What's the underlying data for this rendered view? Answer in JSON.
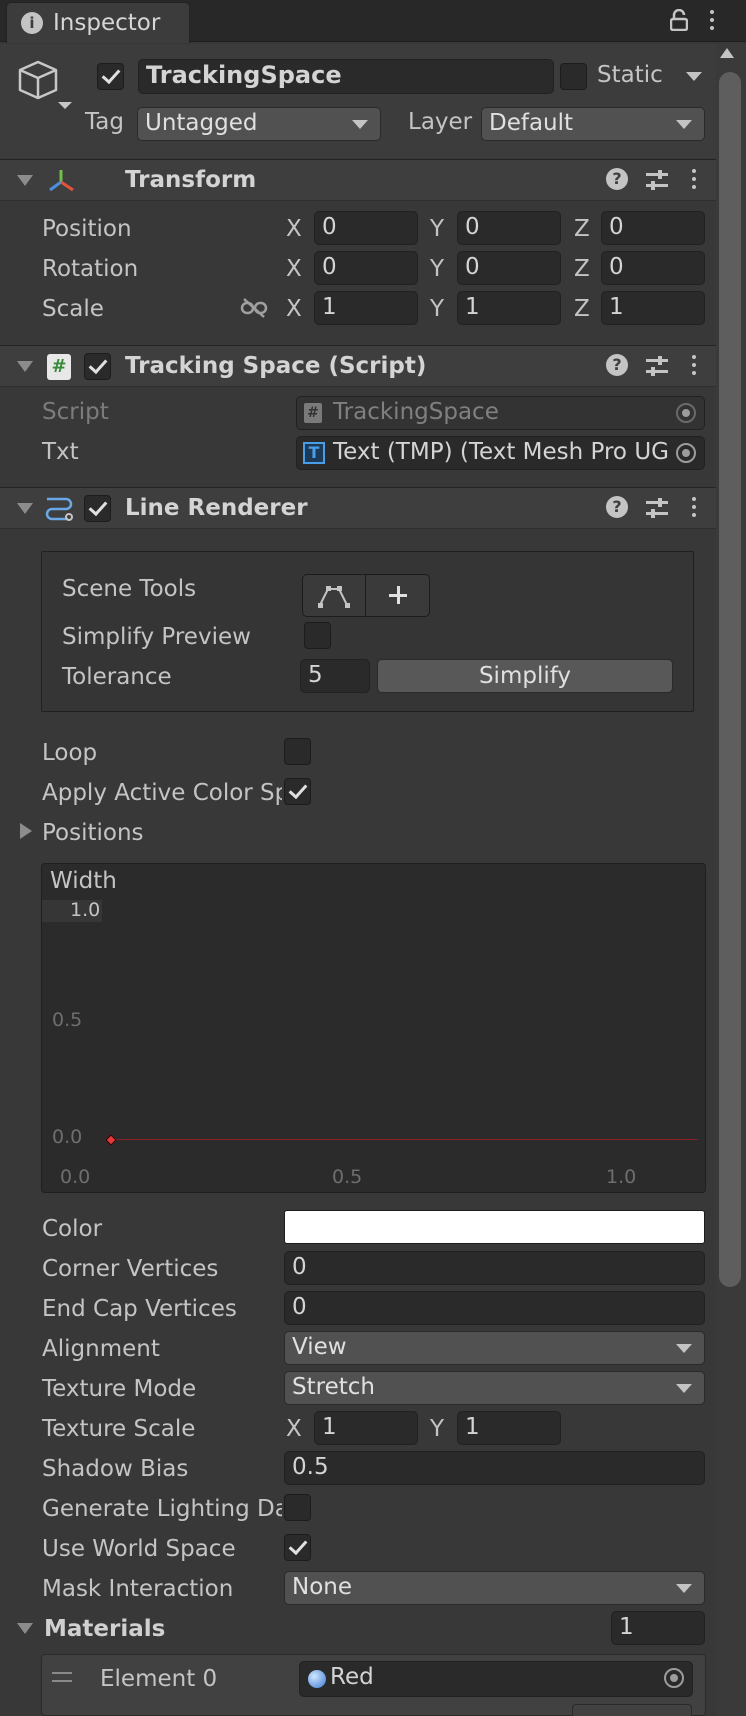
{
  "tab": {
    "title": "Inspector"
  },
  "gameobject": {
    "name": "TrackingSpace",
    "active": true,
    "static_label": "Static",
    "static": false,
    "tag_label": "Tag",
    "tag": "Untagged",
    "layer_label": "Layer",
    "layer": "Default"
  },
  "transform": {
    "title": "Transform",
    "position": {
      "label": "Position",
      "x": "0",
      "y": "0",
      "z": "0"
    },
    "rotation": {
      "label": "Rotation",
      "x": "0",
      "y": "0",
      "z": "0"
    },
    "scale": {
      "label": "Scale",
      "x": "1",
      "y": "1",
      "z": "1"
    },
    "axis_x": "X",
    "axis_y": "Y",
    "axis_z": "Z"
  },
  "tracking_script": {
    "title": "Tracking Space (Script)",
    "enabled": true,
    "script_label": "Script",
    "script_value": "TrackingSpace",
    "txt_label": "Txt",
    "txt_value": "Text (TMP) (Text Mesh Pro UG"
  },
  "line_renderer": {
    "title": "Line Renderer",
    "enabled": true,
    "scene_tools_label": "Scene Tools",
    "simplify_preview_label": "Simplify Preview",
    "tolerance_label": "Tolerance",
    "tolerance_value": "5",
    "simplify_button": "Simplify",
    "loop_label": "Loop",
    "apply_color_label": "Apply Active Color Sp",
    "positions_label": "Positions",
    "width_label": "Width",
    "width_curve": {
      "y_ticks": [
        "1.0",
        "0.5",
        "0.0"
      ],
      "x_ticks": [
        "0.0",
        "0.5",
        "1.0"
      ],
      "key_value": 0.0
    },
    "color_label": "Color",
    "color_value": "#ffffff",
    "corner_label": "Corner Vertices",
    "corner_value": "0",
    "endcap_label": "End Cap Vertices",
    "endcap_value": "0",
    "alignment_label": "Alignment",
    "alignment_value": "View",
    "texture_mode_label": "Texture Mode",
    "texture_mode_value": "Stretch",
    "texture_scale_label": "Texture Scale",
    "texture_scale_x": "1",
    "texture_scale_y": "1",
    "shadow_bias_label": "Shadow Bias",
    "shadow_bias_value": "0.5",
    "gen_lighting_label": "Generate Lighting Da",
    "world_space_label": "Use World Space",
    "mask_label": "Mask Interaction",
    "mask_value": "None",
    "materials_label": "Materials",
    "materials_count": "1",
    "element0_label": "Element 0",
    "element0_value": "Red"
  }
}
